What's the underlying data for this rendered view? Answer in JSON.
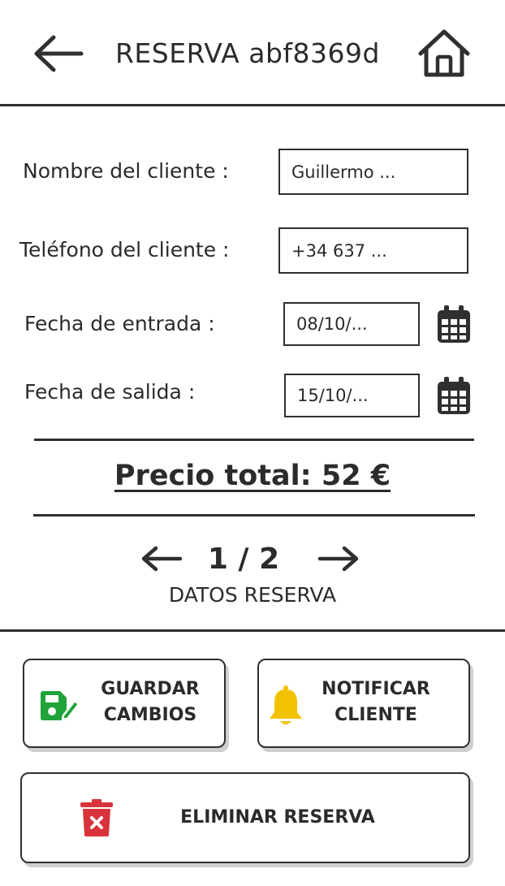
{
  "header": {
    "title": "RESERVA abf8369d",
    "back_icon": "arrow-left-icon",
    "home_icon": "home-icon"
  },
  "form": {
    "client_name": {
      "label": "Nombre del cliente :",
      "value": "Guillermo ..."
    },
    "client_phone": {
      "label": "Teléfono del cliente :",
      "value": "+34 637 ..."
    },
    "check_in": {
      "label": "Fecha de entrada :",
      "value": "08/10/...",
      "icon": "calendar-icon"
    },
    "check_out": {
      "label": "Fecha de salida :",
      "value": "15/10/...",
      "icon": "calendar-icon"
    }
  },
  "total": {
    "text": "Precio total: 52 €"
  },
  "pager": {
    "current": "1 / 2",
    "label": "DATOS RESERVA",
    "prev_icon": "arrow-left-icon",
    "next_icon": "arrow-right-icon"
  },
  "actions": {
    "save": {
      "line1": "GUARDAR",
      "line2": "CAMBIOS",
      "icon": "save-edit-icon"
    },
    "notify": {
      "line1": "NOTIFICAR",
      "line2": "CLIENTE",
      "icon": "bell-icon"
    },
    "delete": {
      "label": "ELIMINAR RESERVA",
      "icon": "trash-icon"
    }
  },
  "colors": {
    "ink": "#2f2f2f",
    "save_green": "#1fa33a",
    "bell_yellow": "#f2c200",
    "delete_red": "#d8333a"
  }
}
